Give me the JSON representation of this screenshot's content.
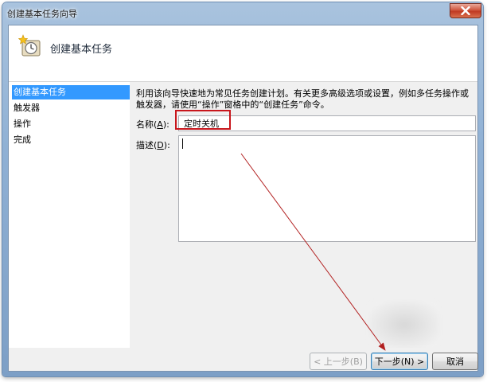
{
  "window": {
    "title": "创建基本任务向导"
  },
  "header": {
    "title": "创建基本任务",
    "icon": "task-scheduler-clock-icon"
  },
  "sidebar": {
    "items": [
      {
        "label": "创建基本任务",
        "active": true
      },
      {
        "label": "触发器",
        "active": false
      },
      {
        "label": "操作",
        "active": false
      },
      {
        "label": "完成",
        "active": false
      }
    ]
  },
  "content": {
    "intro": "利用该向导快速地为常见任务创建计划。有关更多高级选项或设置，例如多任务操作或触发器，请使用“操作”窗格中的“创建任务”命令。",
    "name_label": "名称",
    "name_accel": "A",
    "name_value": "定时关机",
    "desc_label": "描述",
    "desc_accel": "D",
    "desc_value": ""
  },
  "footer": {
    "back_label": "< 上一步(B)",
    "next_label": "下一步(N) >",
    "cancel_label": "取消"
  },
  "colors": {
    "highlight": "#c8161c",
    "annotation_arrow": "#b22020",
    "selection": "#3399ff"
  }
}
